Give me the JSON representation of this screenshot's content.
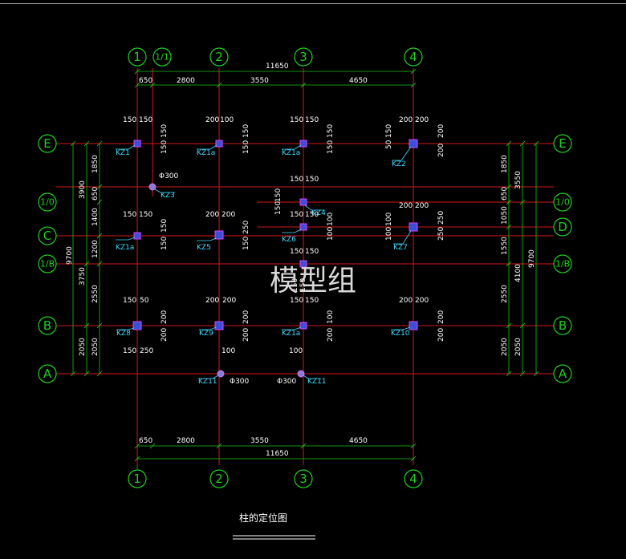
{
  "axes_top": [
    "1",
    "1/1",
    "2",
    "3",
    "4"
  ],
  "axes_side_left": [
    "E",
    "1/0",
    "C",
    "1/B",
    "B",
    "A"
  ],
  "axes_side_right": [
    "E",
    "1/0",
    "D",
    "1/B",
    "B",
    "A"
  ],
  "top_dims": {
    "total": "11650",
    "segments": [
      "650",
      "2800",
      "3550",
      "4650"
    ]
  },
  "bottom_dims": {
    "total": "11650",
    "segments": [
      "650",
      "2800",
      "3550",
      "4650"
    ]
  },
  "left_dims": {
    "total": "9700",
    "outer": [
      "3900",
      "3750",
      "2050"
    ],
    "inner": [
      "1850",
      "650",
      "1400",
      "1200",
      "2550",
      "2050"
    ]
  },
  "right_dims": {
    "total": "9700",
    "outer": [
      "3550",
      "4100",
      "2050"
    ],
    "inner": [
      "1850",
      "650",
      "1050",
      "1550",
      "2550",
      "2050"
    ]
  },
  "columns": [
    {
      "label": "KZ1",
      "top": "150",
      "top2": "150",
      "side": "150",
      "side2": "150"
    },
    {
      "label": "KZ1a",
      "top": "200",
      "top2": "100",
      "side": "150",
      "side2": "150"
    },
    {
      "label": "KZ1a",
      "top": "150",
      "top2": "150",
      "side": "150",
      "side2": "150"
    },
    {
      "label": "KZ2",
      "top": "200",
      "top2": "200",
      "side": "200",
      "side2": "200",
      "extra1": "50",
      "extra2": "150"
    },
    {
      "label": "KZ3",
      "dia": "Φ300"
    },
    {
      "label": "KZ4",
      "top": "150",
      "top2": "150",
      "extra1": "150",
      "extra2": "150"
    },
    {
      "label": "KZ1a",
      "top": "150",
      "top2": "150",
      "side": "150",
      "side2": "150"
    },
    {
      "label": "KZ5",
      "top": "200",
      "top2": "200",
      "side": "150",
      "side2": "250"
    },
    {
      "label": "KZ6",
      "top": "150",
      "top2": "150",
      "side": "100",
      "side2": "100"
    },
    {
      "label": "KZ7",
      "top": "200",
      "top2": "200",
      "side": "250",
      "side2": "250",
      "extra1": "100",
      "extra2": "100"
    },
    {
      "label": "KZ8",
      "top": "150",
      "top2": "50",
      "side": "200",
      "side2": "200",
      "bot": "150",
      "bot2": "250"
    },
    {
      "label": "KZ9",
      "top": "200",
      "top2": "200",
      "side": "200",
      "side2": "200"
    },
    {
      "label": "KZ1a",
      "top": "150",
      "top2": "150",
      "side": "200",
      "side2": "100"
    },
    {
      "label": "KZ10",
      "top": "200",
      "top2": "200",
      "side": "200",
      "side2": "200"
    },
    {
      "label": "KZ11",
      "top": "100",
      "dia": "Φ300"
    },
    {
      "label": "KZ11",
      "top": "100",
      "dia": "Φ300"
    }
  ],
  "extra_dims": {
    "d150_c": "150",
    "d150_d": "150",
    "d150_e": "150",
    "d150_f": "150"
  },
  "watermark": "模型组",
  "title": "柱的定位图"
}
